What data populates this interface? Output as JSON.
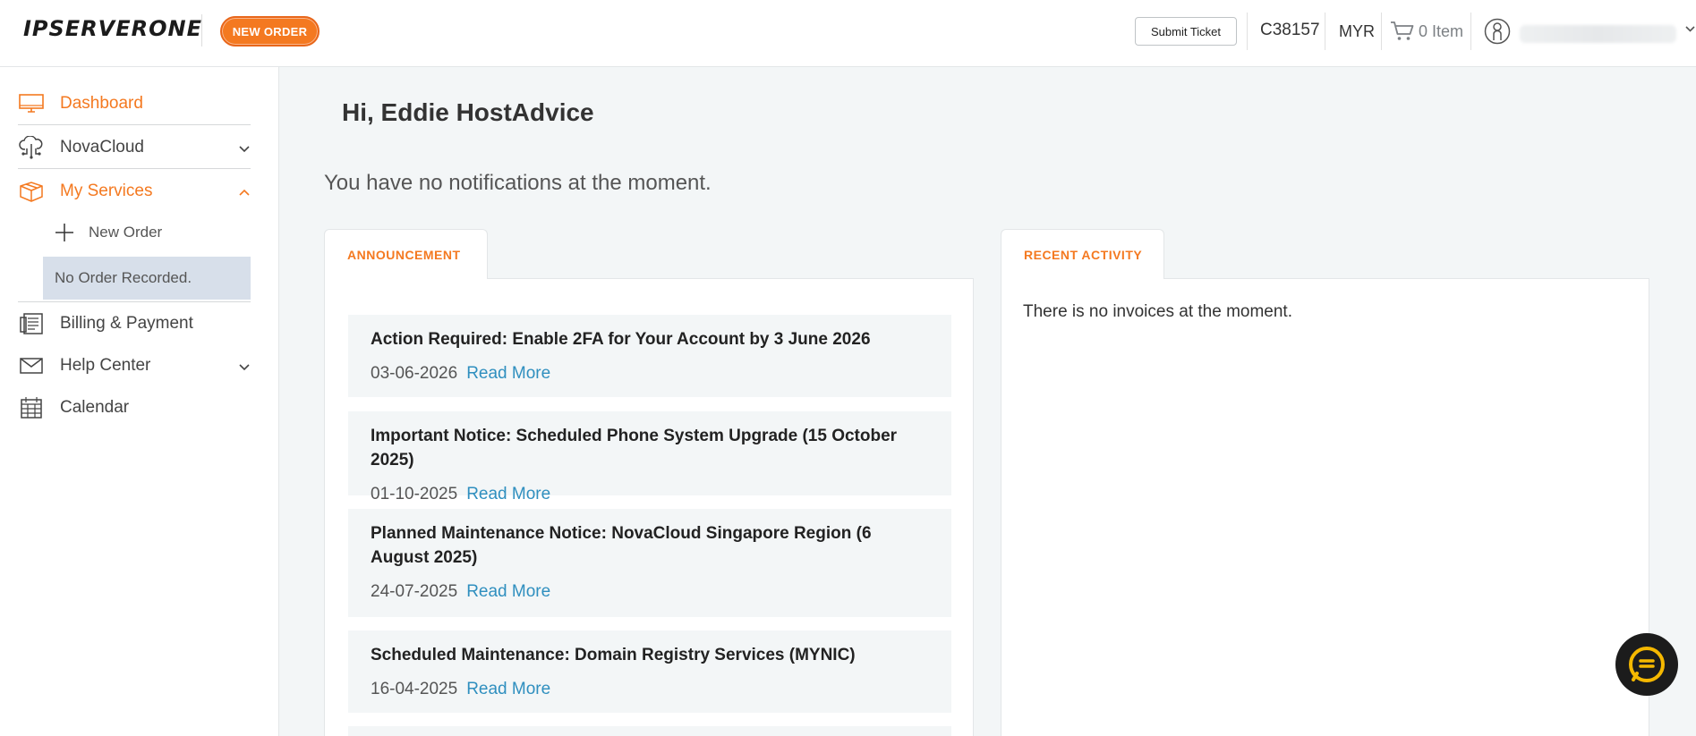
{
  "header": {
    "logo_text": "IPSERVERONE",
    "new_order_label": "NEW ORDER",
    "submit_ticket_label": "Submit Ticket",
    "client_id": "C38157",
    "currency": "MYR",
    "cart_label": "0 Item"
  },
  "sidebar": {
    "items": [
      {
        "label": "Dashboard",
        "icon": "monitor-icon",
        "active": true
      },
      {
        "label": "NovaCloud",
        "icon": "cloud-icon",
        "expandable": true
      },
      {
        "label": "My Services",
        "icon": "box-icon",
        "active": true,
        "expanded": true
      },
      {
        "label": "Billing & Payment",
        "icon": "billing-icon"
      },
      {
        "label": "Help Center",
        "icon": "envelope-icon",
        "expandable": true
      },
      {
        "label": "Calendar",
        "icon": "calendar-icon"
      }
    ],
    "sub_new_order": "New Order",
    "no_order": "No Order Recorded."
  },
  "main": {
    "greeting": "Hi, Eddie HostAdvice",
    "notifications_text": "You have no notifications at the moment.",
    "announcement_tab": "ANNOUNCEMENT",
    "recent_activity_tab": "RECENT ACTIVITY",
    "announcements": [
      {
        "title": "Action Required: Enable 2FA for Your Account by 3 June 2026",
        "date": "03-06-2026",
        "link": "Read More"
      },
      {
        "title": "Important Notice: Scheduled Phone System Upgrade (15 October 2025)",
        "date": "01-10-2025",
        "link": "Read More"
      },
      {
        "title": "Planned Maintenance Notice: NovaCloud Singapore Region (6 August 2025)",
        "date": "24-07-2025",
        "link": "Read More"
      },
      {
        "title": "Scheduled Maintenance: Domain Registry Services (MYNIC)",
        "date": "16-04-2025",
        "link": "Read More"
      }
    ],
    "recent_activity_text": "There is no invoices at the moment."
  },
  "colors": {
    "accent": "#f47920",
    "link": "#2f8fbf",
    "chat_ring": "#f5b800"
  }
}
